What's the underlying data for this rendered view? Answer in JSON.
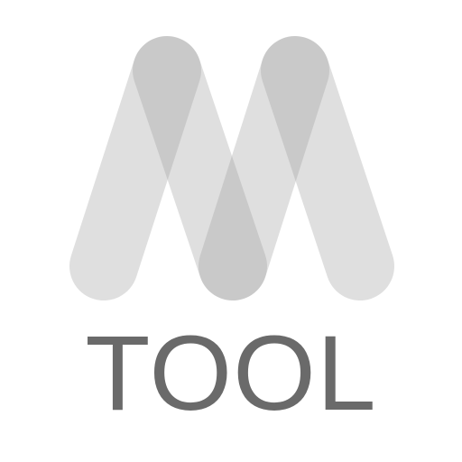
{
  "logo": {
    "wordmark": "TOOL",
    "wordmark_color": "#6a6a6a",
    "stroke_color": "#9a9a9a",
    "stroke_opacity": 0.32,
    "background_color": "#ffffff",
    "icon_name": "m-logo-icon"
  }
}
